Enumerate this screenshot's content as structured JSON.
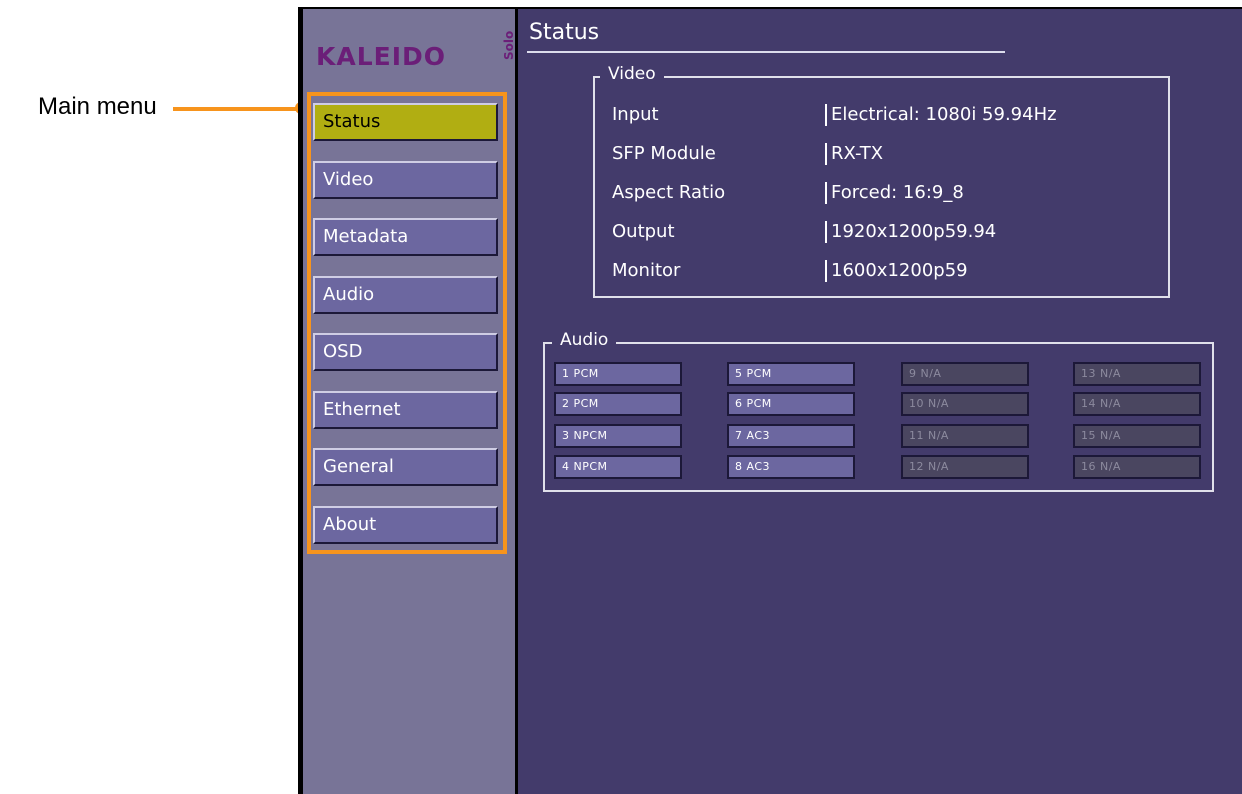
{
  "callout": {
    "label": "Main menu"
  },
  "logo": {
    "brand": "KALEIDO",
    "sub": "Solo"
  },
  "menu": {
    "items": [
      {
        "label": "Status",
        "active": true
      },
      {
        "label": "Video"
      },
      {
        "label": "Metadata"
      },
      {
        "label": "Audio"
      },
      {
        "label": "OSD"
      },
      {
        "label": "Ethernet"
      },
      {
        "label": "General"
      },
      {
        "label": "About"
      }
    ]
  },
  "status": {
    "title": "Status",
    "video": {
      "legend": "Video",
      "rows": [
        {
          "label": "Input",
          "value": "Electrical: 1080i 59.94Hz"
        },
        {
          "label": "SFP Module",
          "value": "RX-TX"
        },
        {
          "label": "Aspect Ratio",
          "value": "Forced: 16:9_8"
        },
        {
          "label": "Output",
          "value": "1920x1200p59.94"
        },
        {
          "label": "Monitor",
          "value": "1600x1200p59"
        }
      ]
    },
    "audio": {
      "legend": "Audio",
      "channels": [
        "1 PCM",
        "2 PCM",
        "3 NPCM",
        "4 NPCM",
        "5 PCM",
        "6 PCM",
        "7 AC3",
        "8 AC3",
        "9 N/A",
        "10 N/A",
        "11 N/A",
        "12 N/A",
        "13 N/A",
        "14 N/A",
        "15 N/A",
        "16 N/A"
      ]
    }
  },
  "colors": {
    "accent_callout": "#f7941d",
    "menu_active": "#b1ae12",
    "menu_item": "#6c67a0",
    "panel_bg": "#433b6b",
    "sidebar_bg": "#787497",
    "logo": "#6b1e78"
  }
}
